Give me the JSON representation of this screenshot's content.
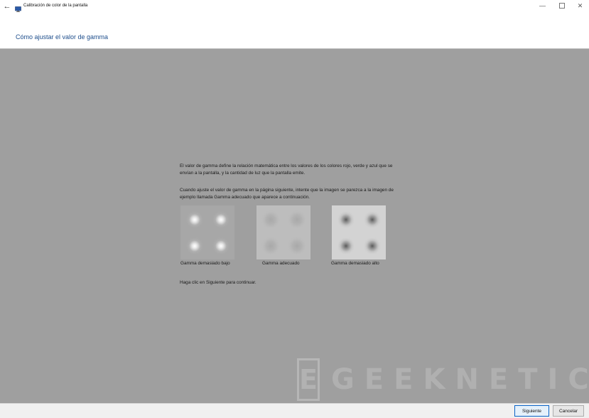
{
  "window": {
    "title": "Calibración de color de la pantalla",
    "back_icon": "back-arrow-icon",
    "app_icon": "display-monitor-icon",
    "controls": {
      "minimize_icon": "minimize-icon",
      "maximize_icon": "maximize-icon",
      "close_icon": "close-icon"
    }
  },
  "header": {
    "heading": "Cómo ajustar el valor de gamma"
  },
  "content": {
    "paragraph_1": "El valor de gamma define la relación matemática entre los valores de los colores rojo, verde y azul que se envían a la pantalla, y la cantidad de luz que la pantalla emite.",
    "paragraph_2": "Cuando ajuste el valor de gamma en la página siguiente, intente que la imagen se parezca a la imagen de ejemplo llamada Gamma adecuado que aparece a continuación.",
    "samples": [
      {
        "caption": "Gamma demasiado bajo"
      },
      {
        "caption": "Gamma adecuado"
      },
      {
        "caption": "Gamma demasiado alto"
      }
    ],
    "instruction": "Haga clic en Siguiente para continuar."
  },
  "watermark": {
    "logo_letter": "E",
    "text": "GEEKNETIC"
  },
  "footer": {
    "next_label": "Siguiente",
    "cancel_label": "Cancelar"
  },
  "colors": {
    "heading_blue": "#1e4e8c",
    "content_gray": "#9f9f9f",
    "primary_border": "#0a64c8"
  }
}
